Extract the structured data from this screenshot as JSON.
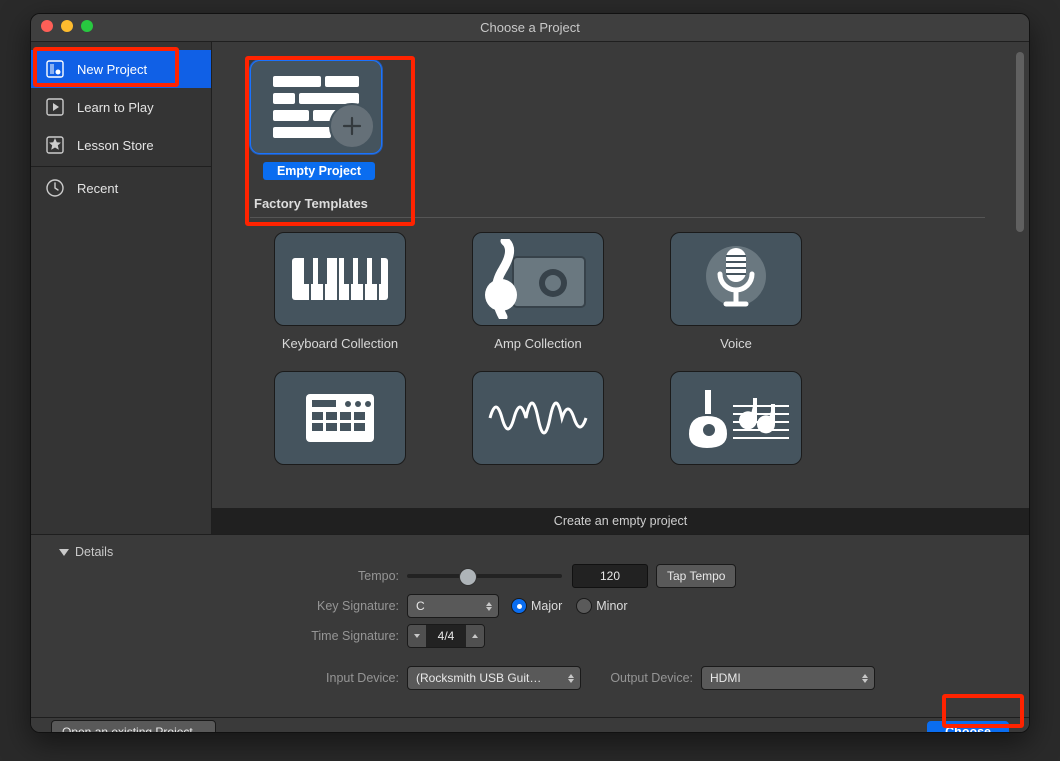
{
  "window": {
    "title": "Choose a Project"
  },
  "sidebar": {
    "items": [
      {
        "label": "New Project"
      },
      {
        "label": "Learn to Play"
      },
      {
        "label": "Lesson Store"
      },
      {
        "label": "Recent"
      }
    ]
  },
  "main": {
    "selected_template_label": "Empty Project",
    "section_header": "Factory Templates",
    "templates": [
      {
        "label": "Keyboard Collection"
      },
      {
        "label": "Amp Collection"
      },
      {
        "label": "Voice"
      }
    ],
    "description": "Create an empty project"
  },
  "details": {
    "header": "Details",
    "tempo_label": "Tempo:",
    "tempo_value": "120",
    "tap_tempo": "Tap Tempo",
    "key_label": "Key Signature:",
    "key_value": "C",
    "scale_major": "Major",
    "scale_minor": "Minor",
    "time_label": "Time Signature:",
    "time_value": "4/4",
    "input_label": "Input Device:",
    "input_value": "(Rocksmith USB Guit…",
    "output_label": "Output Device:",
    "output_value": "HDMI"
  },
  "footer": {
    "open_existing": "Open an existing Project…",
    "choose": "Choose"
  }
}
